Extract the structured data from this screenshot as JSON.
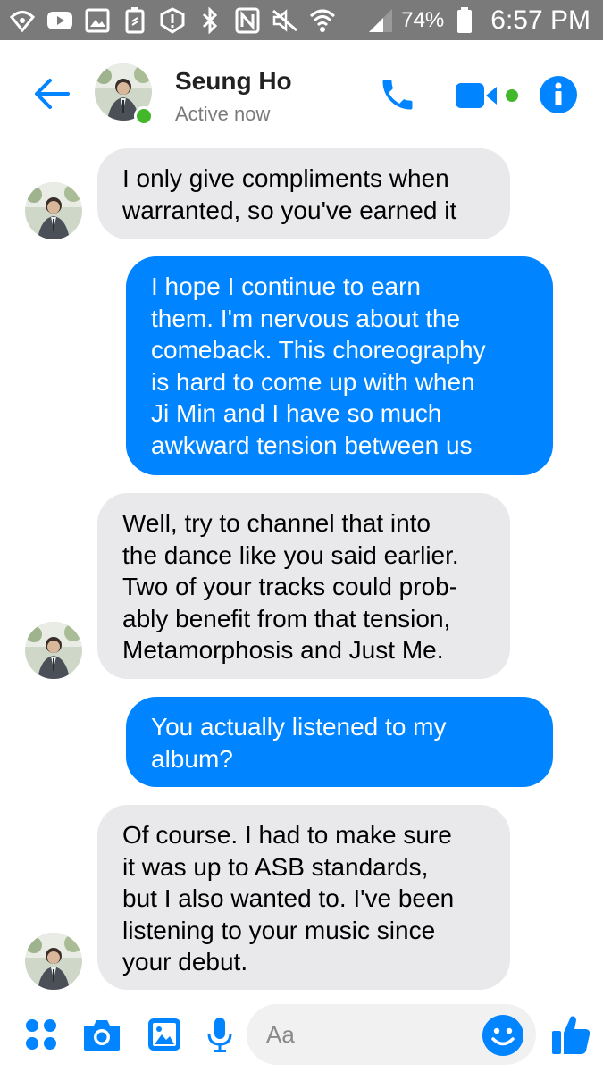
{
  "status_bar": {
    "battery_percent": "74%",
    "time": "6:57 PM",
    "icons": [
      "wifi-calling-icon",
      "youtube-icon",
      "gallery-icon",
      "battery-saver-icon",
      "alert-icon",
      "bluetooth-icon",
      "nfc-icon",
      "mute-icon",
      "wifi-icon",
      "signal-icon",
      "battery-icon"
    ]
  },
  "header": {
    "contact_name": "Seung Ho",
    "contact_status": "Active now",
    "accent_color": "#0084ff",
    "active_color": "#42b72a"
  },
  "messages": [
    {
      "direction": "incoming",
      "lines": [
        "I only give compliments when",
        "warranted, so you've earned it"
      ]
    },
    {
      "direction": "outgoing",
      "lines": [
        "I hope I continue to earn",
        "them. I'm nervous about the",
        "comeback. This choreography",
        "is hard to come up with when",
        "Ji Min and I have so much",
        "awkward tension between us"
      ]
    },
    {
      "direction": "incoming",
      "lines": [
        "Well, try to channel that into",
        "the dance like you said earlier.",
        "Two of your tracks could prob-",
        "ably benefit from that tension,",
        "Metamorphosis and Just Me."
      ]
    },
    {
      "direction": "outgoing",
      "lines": [
        "You actually listened to my",
        "album?"
      ]
    },
    {
      "direction": "incoming",
      "lines": [
        "Of course. I had to make sure",
        "it was up to ASB standards,",
        "but I also wanted to. I've been",
        "listening to your music since",
        "your debut."
      ]
    }
  ],
  "composer": {
    "placeholder": "Aa"
  },
  "colors": {
    "incoming_bubble": "#e9e9eb",
    "outgoing_bubble": "#0084ff",
    "status_bar": "#7a7a7a"
  }
}
